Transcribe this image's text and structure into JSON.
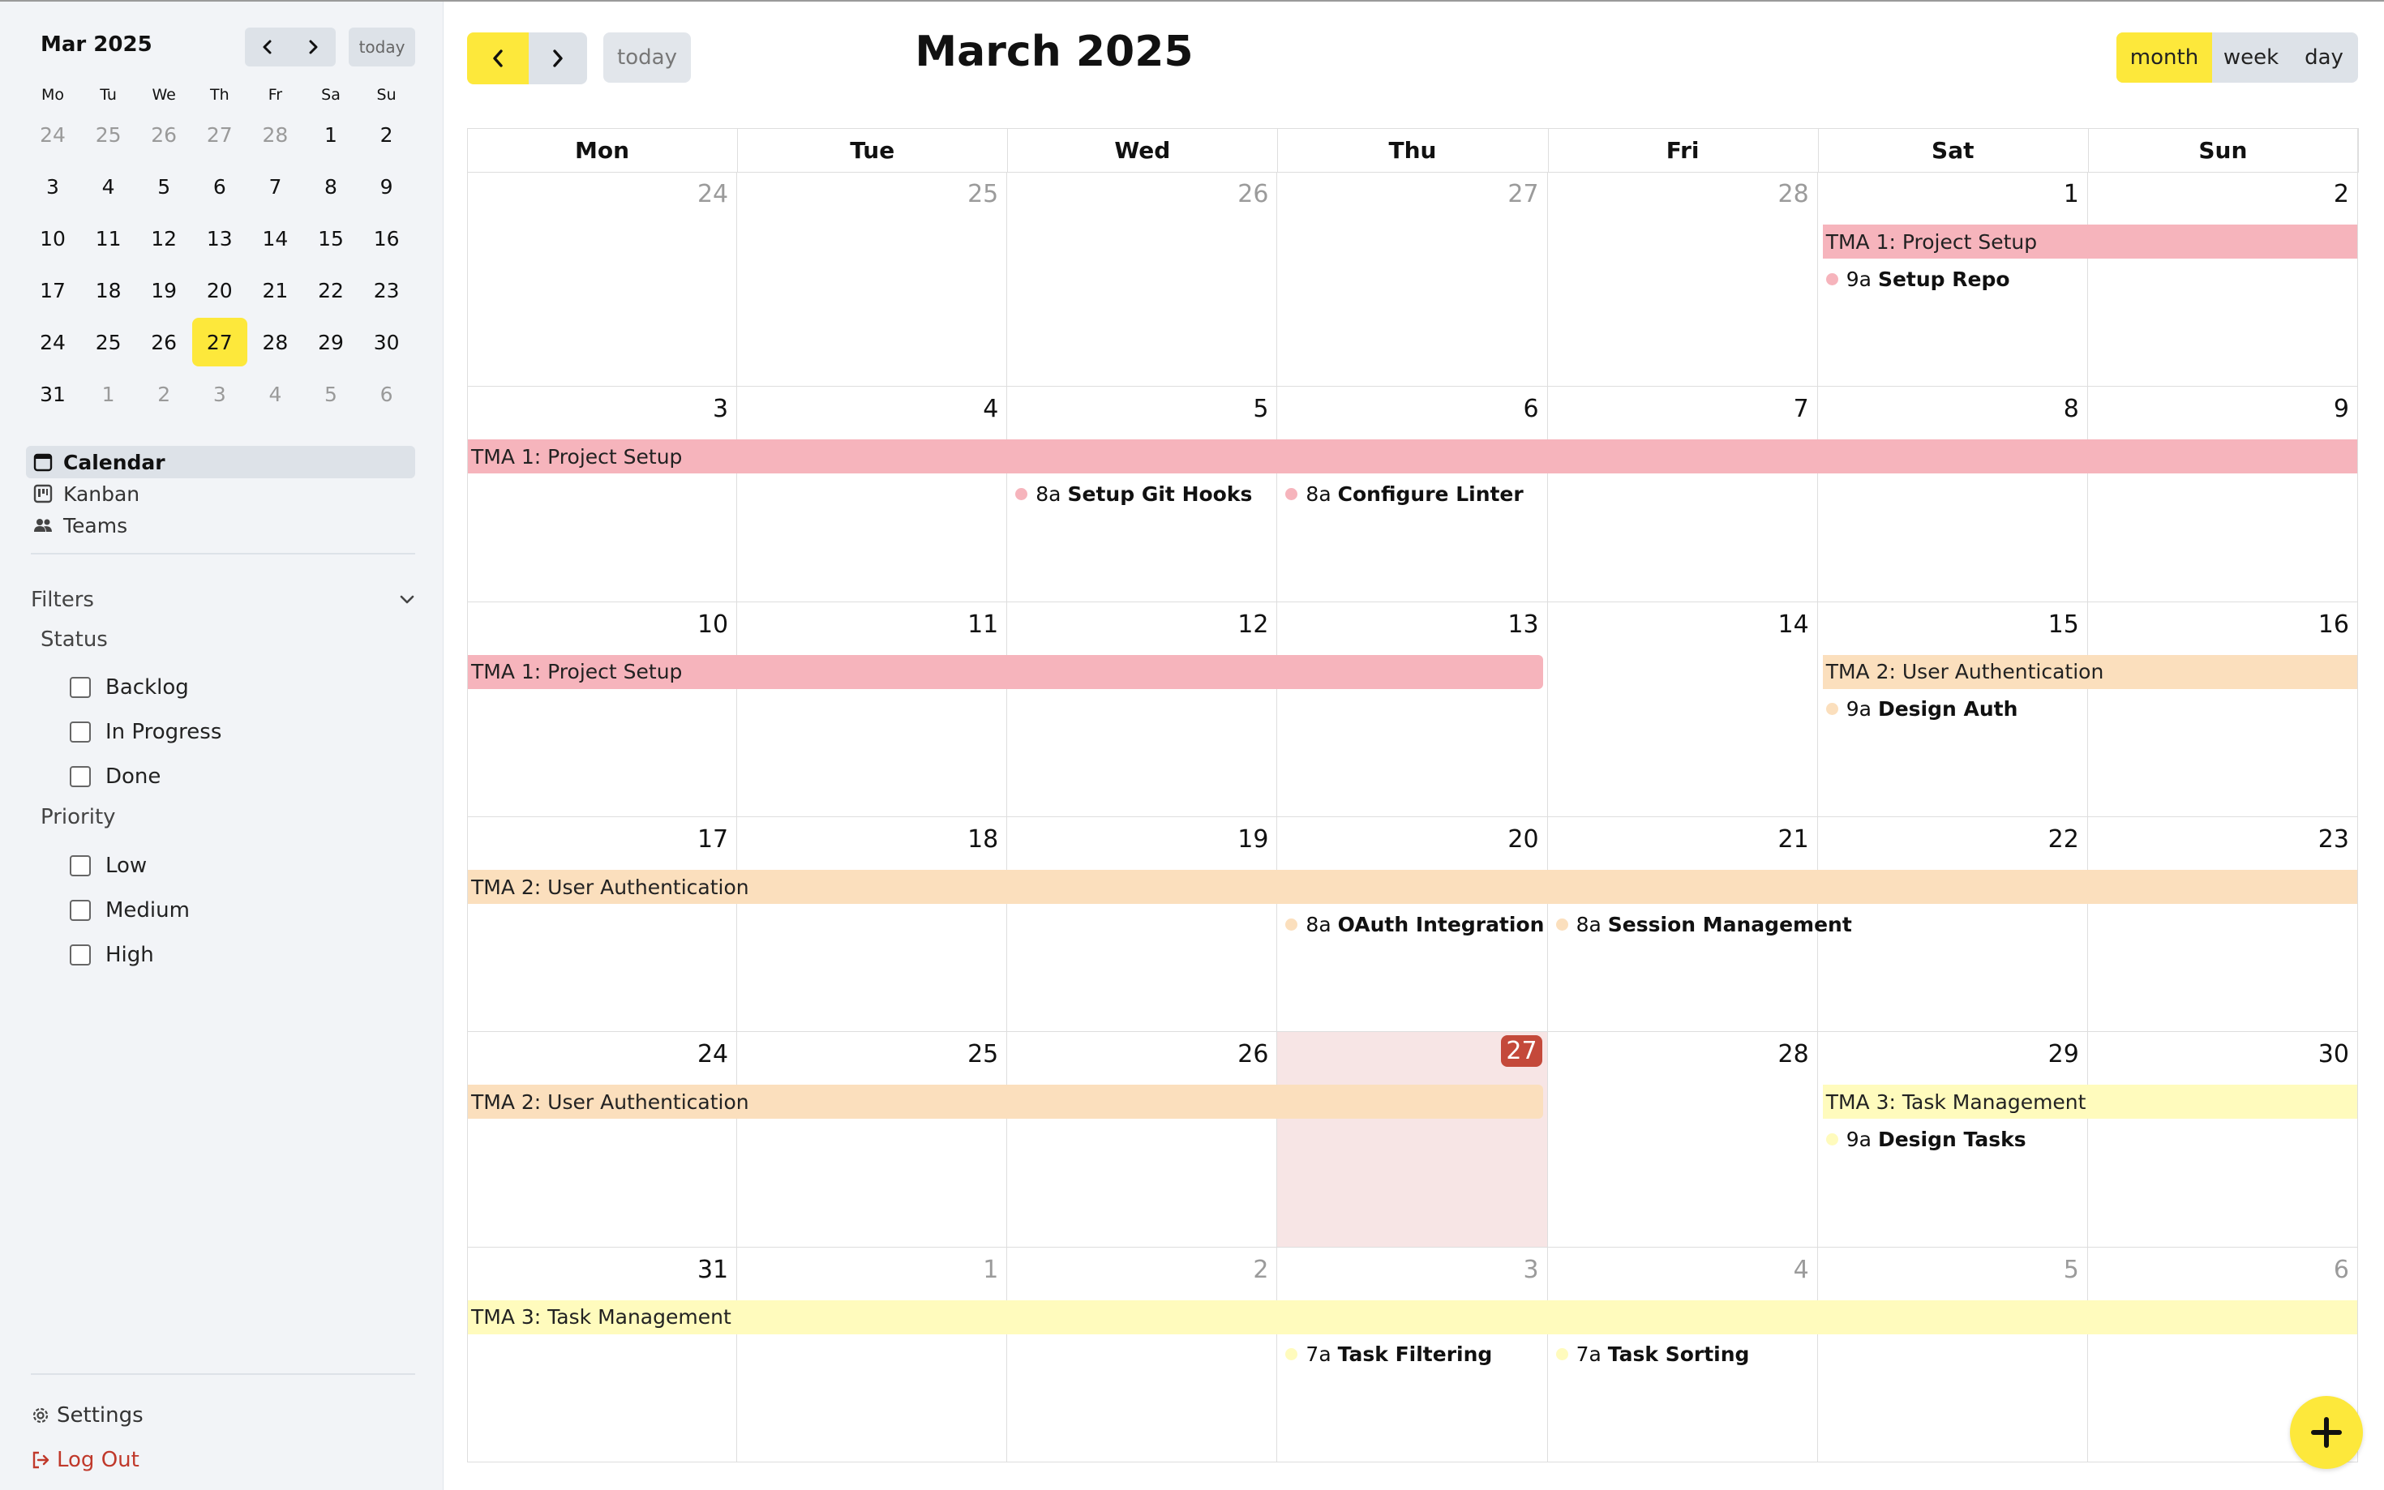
{
  "sidebar": {
    "mini_calendar": {
      "title": "Mar 2025",
      "today_label": "today",
      "weekdays": [
        "Mo",
        "Tu",
        "We",
        "Th",
        "Fr",
        "Sa",
        "Su"
      ],
      "weeks": [
        [
          "24",
          "25",
          "26",
          "27",
          "28",
          "1",
          "2"
        ],
        [
          "3",
          "4",
          "5",
          "6",
          "7",
          "8",
          "9"
        ],
        [
          "10",
          "11",
          "12",
          "13",
          "14",
          "15",
          "16"
        ],
        [
          "17",
          "18",
          "19",
          "20",
          "21",
          "22",
          "23"
        ],
        [
          "24",
          "25",
          "26",
          "27",
          "28",
          "29",
          "30"
        ],
        [
          "31",
          "1",
          "2",
          "3",
          "4",
          "5",
          "6"
        ]
      ]
    },
    "nav": [
      {
        "label": "Calendar",
        "icon": "calendar-icon"
      },
      {
        "label": "Kanban",
        "icon": "kanban-icon"
      },
      {
        "label": "Teams",
        "icon": "users-icon"
      }
    ],
    "filters": {
      "title": "Filters",
      "status_label": "Status",
      "status_options": [
        "Backlog",
        "In Progress",
        "Done"
      ],
      "priority_label": "Priority",
      "priority_options": [
        "Low",
        "Medium",
        "High"
      ]
    },
    "settings_label": "Settings",
    "logout_label": "Log Out"
  },
  "toolbar": {
    "today_label": "today",
    "title": "March 2025",
    "views": {
      "month": "month",
      "week": "week",
      "day": "day"
    }
  },
  "calendar": {
    "weekday_headers": [
      "Mon",
      "Tue",
      "Wed",
      "Thu",
      "Fri",
      "Sat",
      "Sun"
    ],
    "weeks": [
      [
        "24",
        "25",
        "26",
        "27",
        "28",
        "1",
        "2"
      ],
      [
        "3",
        "4",
        "5",
        "6",
        "7",
        "8",
        "9"
      ],
      [
        "10",
        "11",
        "12",
        "13",
        "14",
        "15",
        "16"
      ],
      [
        "17",
        "18",
        "19",
        "20",
        "21",
        "22",
        "23"
      ],
      [
        "24",
        "25",
        "26",
        "27",
        "28",
        "29",
        "30"
      ],
      [
        "31",
        "1",
        "2",
        "3",
        "4",
        "5",
        "6"
      ]
    ],
    "bars": [
      {
        "label": "TMA 1: Project Setup",
        "week": 0,
        "start": 5,
        "end": 6
      },
      {
        "label": "TMA 1: Project Setup",
        "week": 1,
        "start": 0,
        "end": 6
      },
      {
        "label": "TMA 1: Project Setup",
        "week": 2,
        "start": 0,
        "end": 3
      },
      {
        "label": "TMA 2: User Authentication",
        "week": 2,
        "start": 5,
        "end": 6
      },
      {
        "label": "TMA 2: User Authentication",
        "week": 3,
        "start": 0,
        "end": 6
      },
      {
        "label": "TMA 2: User Authentication",
        "week": 4,
        "start": 0,
        "end": 3
      },
      {
        "label": "TMA 3: Task Management",
        "week": 4,
        "start": 5,
        "end": 6
      },
      {
        "label": "TMA 3: Task Management",
        "week": 5,
        "start": 0,
        "end": 6
      }
    ],
    "events": [
      {
        "time": "9a",
        "title": "Setup Repo",
        "week": 0,
        "day": 5
      },
      {
        "time": "8a",
        "title": "Setup Git Hooks",
        "week": 1,
        "day": 2
      },
      {
        "time": "8a",
        "title": "Configure Linter",
        "week": 1,
        "day": 3
      },
      {
        "time": "9a",
        "title": "Design Auth",
        "week": 2,
        "day": 5
      },
      {
        "time": "8a",
        "title": "OAuth Integration",
        "week": 3,
        "day": 3
      },
      {
        "time": "8a",
        "title": "Session Management",
        "week": 3,
        "day": 4
      },
      {
        "time": "9a",
        "title": "Design Tasks",
        "week": 4,
        "day": 5
      },
      {
        "time": "7a",
        "title": "Task Filtering",
        "week": 5,
        "day": 3
      },
      {
        "time": "7a",
        "title": "Task Sorting",
        "week": 5,
        "day": 4
      }
    ]
  },
  "colors": {
    "accent": "#fde83b",
    "today_badge": "#c4493a",
    "tma1": "#f6b4bc",
    "tma2": "#fbdfbd",
    "tma3": "#fffbbd",
    "logout": "#c0392b"
  }
}
